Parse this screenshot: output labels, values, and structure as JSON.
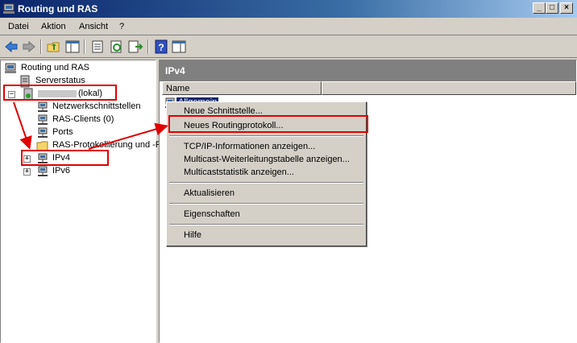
{
  "window": {
    "title": "Routing und RAS"
  },
  "menu": [
    "Datei",
    "Aktion",
    "Ansicht",
    "?"
  ],
  "toolbar": {
    "icons": [
      "back-arrow-icon",
      "forward-arrow-icon",
      "up-folder-icon",
      "console-tree-icon",
      "properties-icon",
      "refresh-icon",
      "export-icon",
      "help-icon",
      "show-pane-icon"
    ]
  },
  "tree": {
    "root": "Routing und RAS",
    "serverstatus": "Serverstatus",
    "server": "(lokal)",
    "items": [
      "Netzwerkschnittstellen",
      "RAS-Clients (0)",
      "Ports",
      "RAS-Protokollierung und -R",
      "IPv4",
      "IPv6"
    ]
  },
  "right": {
    "header": "IPv4",
    "column": "Name",
    "selected_item": "Allgemein"
  },
  "context_menu": {
    "items": [
      "Neue Schnittstelle...",
      "Neues Routingprotokoll...",
      "TCP/IP-Informationen anzeigen...",
      "Multicast-Weiterleitungstabelle anzeigen...",
      "Multicaststatistik anzeigen...",
      "Aktualisieren",
      "Eigenschaften",
      "Hilfe"
    ]
  },
  "colors": {
    "annotation": "#e00000",
    "title_bar": "#0a246a",
    "selection": "#0a246a"
  }
}
